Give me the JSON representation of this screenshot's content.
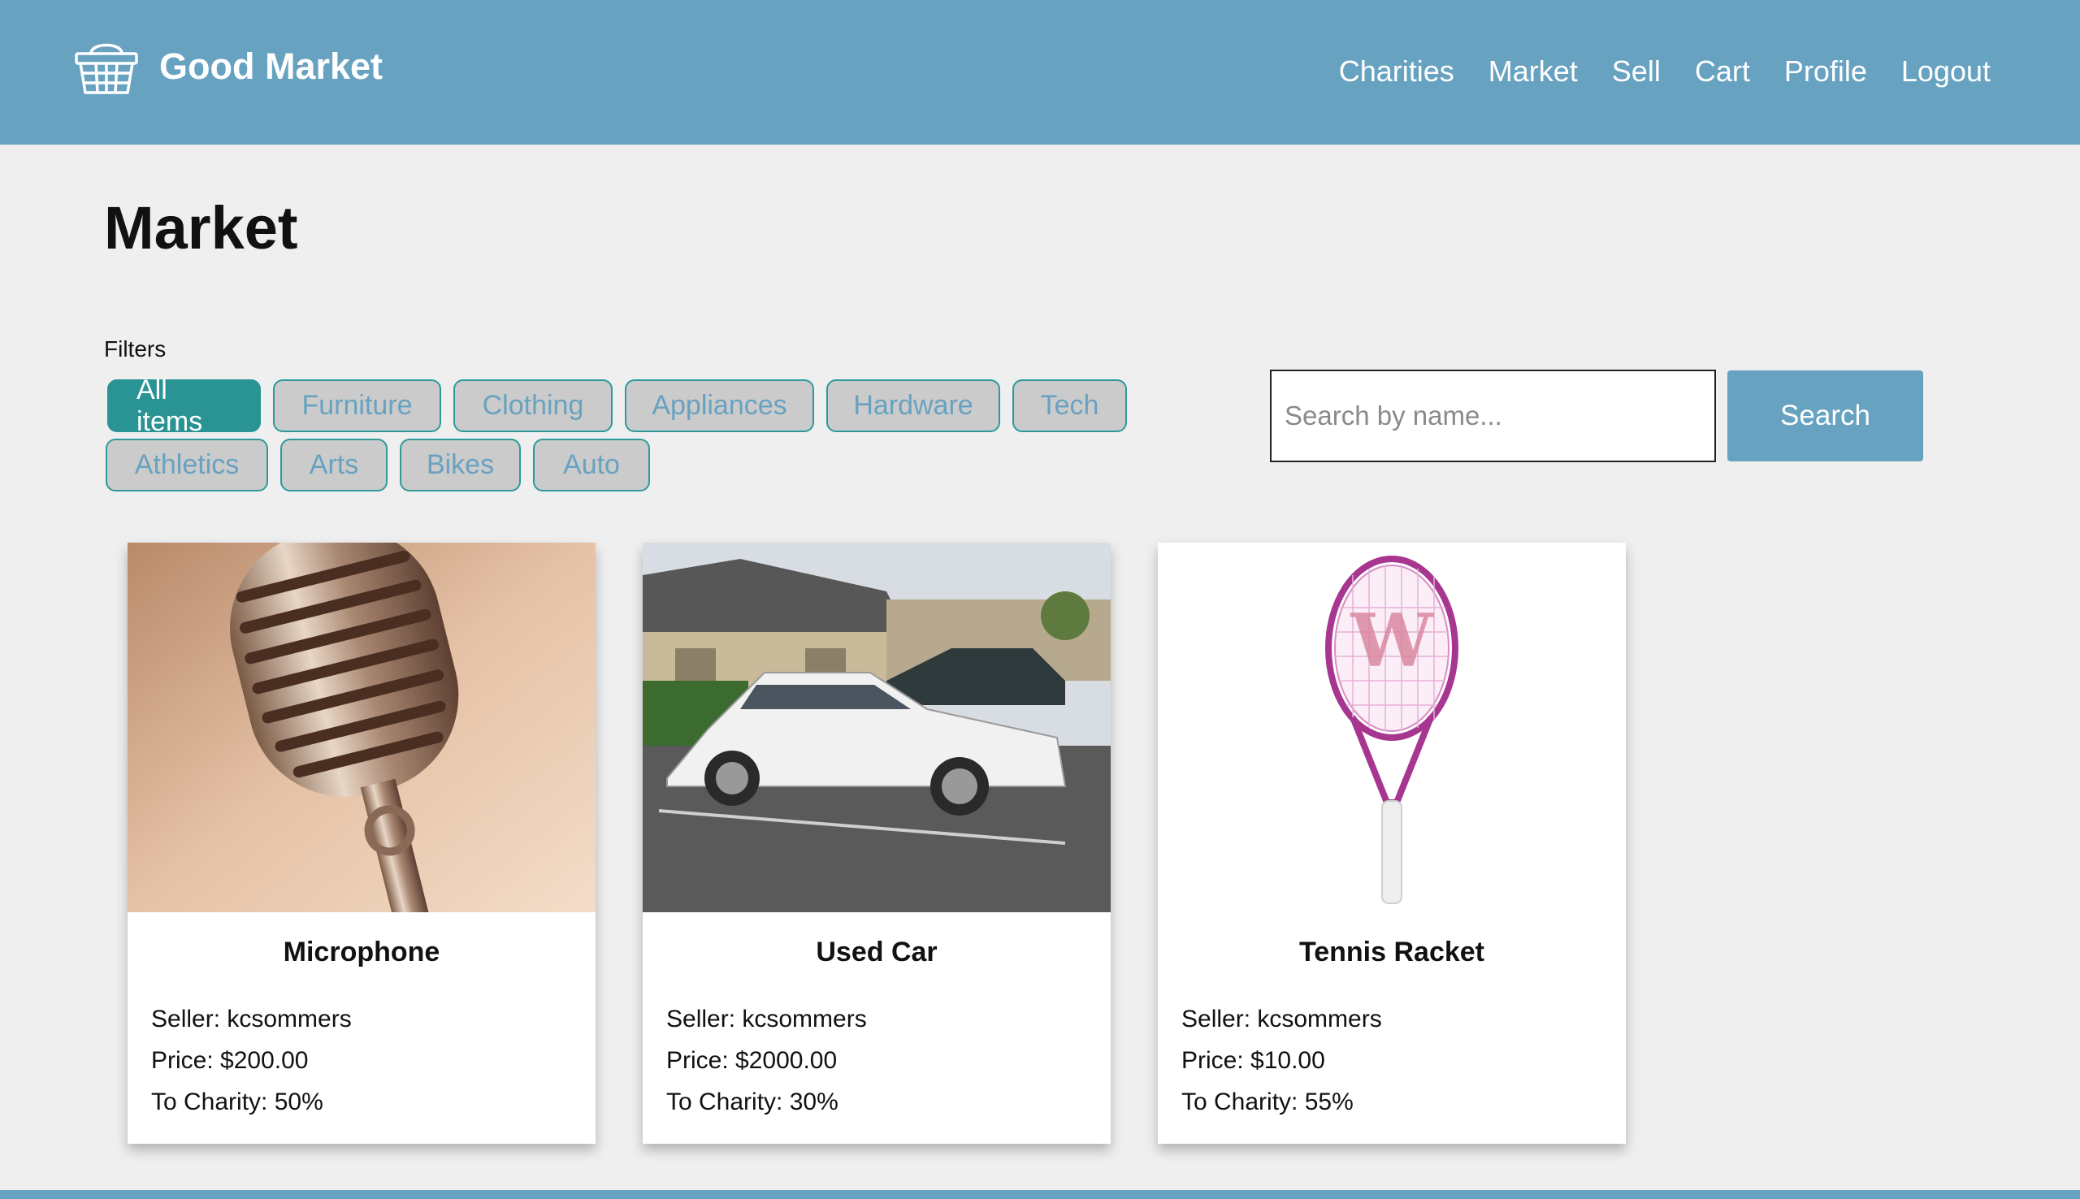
{
  "app": {
    "brand": "Good Market",
    "brand_icon": "basket-icon"
  },
  "nav": {
    "items": [
      "Charities",
      "Market",
      "Sell",
      "Cart",
      "Profile",
      "Logout"
    ]
  },
  "page": {
    "title": "Market"
  },
  "filters": {
    "label": "Filters",
    "chips": [
      "All items",
      "Furniture",
      "Clothing",
      "Appliances",
      "Hardware",
      "Tech",
      "Athletics",
      "Arts",
      "Bikes",
      "Auto"
    ],
    "active": "All items"
  },
  "search": {
    "placeholder": "Search by name...",
    "value": "",
    "button_label": "Search"
  },
  "items": [
    {
      "title": "Microphone",
      "seller": "Seller: kcsommers",
      "price": "Price: $200.00",
      "charity": "To Charity: 50%",
      "image_icon": "microphone-image"
    },
    {
      "title": "Used Car",
      "seller": "Seller: kcsommers",
      "price": "Price: $2000.00",
      "charity": "To Charity: 30%",
      "image_icon": "car-image"
    },
    {
      "title": "Tennis Racket",
      "seller": "Seller: kcsommers",
      "price": "Price: $10.00",
      "charity": "To Charity: 55%",
      "image_icon": "tennis-racket-image"
    }
  ],
  "colors": {
    "header": "#68a2c1",
    "accent": "#2a9393",
    "background": "#efefef"
  }
}
